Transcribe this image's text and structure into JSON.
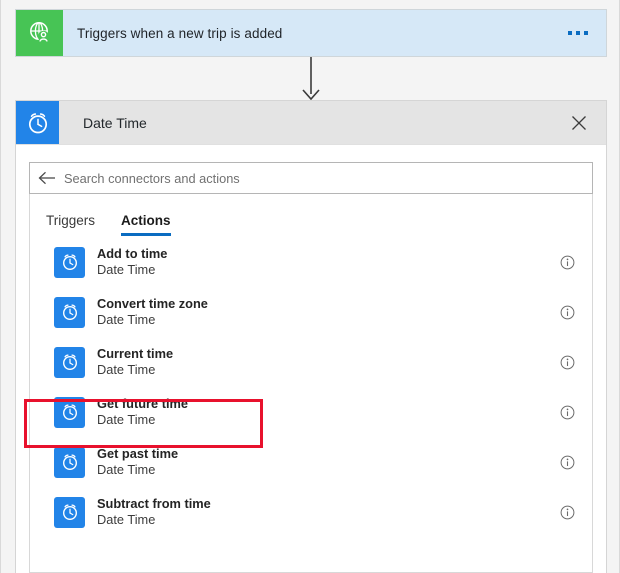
{
  "trigger": {
    "icon": "globe-person-icon",
    "title": "Triggers when a new trip is added",
    "overflow_menu": "…",
    "bg_color": "#d6e8f7",
    "icon_bg_color": "#47c455"
  },
  "connector": {
    "icon": "down-arrow-icon"
  },
  "panel": {
    "icon": "alarm-clock-icon",
    "title": "Date Time",
    "close_label": "Close",
    "icon_bg_color": "#2284e8",
    "header_bg_color": "#e4e4e4"
  },
  "search": {
    "back_icon": "back-arrow-icon",
    "placeholder": "Search connectors and actions",
    "value": ""
  },
  "tabs": [
    {
      "label": "Triggers",
      "active": false
    },
    {
      "label": "Actions",
      "active": true
    }
  ],
  "accent_color": "#0a6cc1",
  "highlight_color": "#e8112d",
  "list": [
    {
      "title": "Add to time",
      "subtitle": "Date Time",
      "icon": "alarm-clock-icon",
      "info_icon": "info-icon",
      "highlighted": false
    },
    {
      "title": "Convert time zone",
      "subtitle": "Date Time",
      "icon": "alarm-clock-icon",
      "info_icon": "info-icon",
      "highlighted": false
    },
    {
      "title": "Current time",
      "subtitle": "Date Time",
      "icon": "alarm-clock-icon",
      "info_icon": "info-icon",
      "highlighted": true
    },
    {
      "title": "Get future time",
      "subtitle": "Date Time",
      "icon": "alarm-clock-icon",
      "info_icon": "info-icon",
      "highlighted": false
    },
    {
      "title": "Get past time",
      "subtitle": "Date Time",
      "icon": "alarm-clock-icon",
      "info_icon": "info-icon",
      "highlighted": false
    },
    {
      "title": "Subtract from time",
      "subtitle": "Date Time",
      "icon": "alarm-clock-icon",
      "info_icon": "info-icon",
      "highlighted": false
    }
  ]
}
